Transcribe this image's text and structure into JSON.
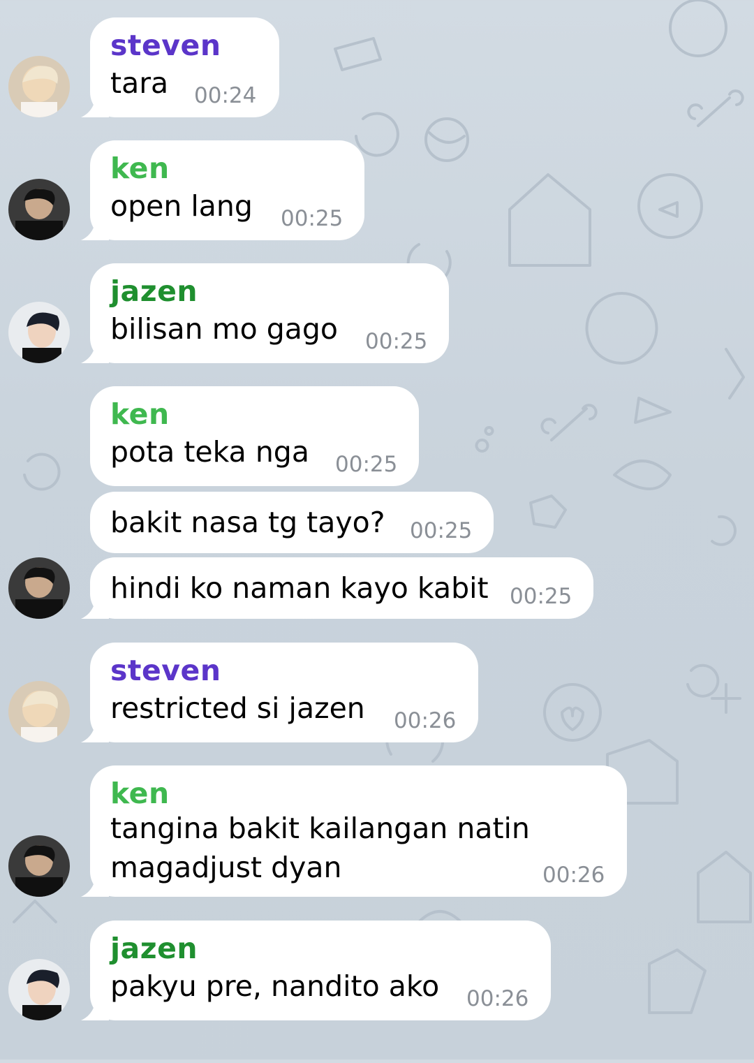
{
  "colors": {
    "steven": "#5b35c9",
    "ken": "#3fb84f",
    "jazen": "#1f8f2f",
    "bubble": "#ffffff",
    "time": "#8a8f96"
  },
  "messages": [
    {
      "sender": "steven",
      "text": "tara",
      "time": "00:24",
      "avatar": "steven-avatar"
    },
    {
      "sender": "ken",
      "text": "open lang",
      "time": "00:25",
      "avatar": "ken-avatar"
    },
    {
      "sender": "jazen",
      "text": "bilisan mo gago",
      "time": "00:25",
      "avatar": "jazen-avatar"
    },
    {
      "sender": "ken",
      "text": "pota teka nga",
      "time": "00:25"
    },
    {
      "text": "bakit nasa tg tayo?",
      "time": "00:25"
    },
    {
      "text": "hindi ko naman kayo kabit",
      "time": "00:25",
      "avatar": "ken-avatar"
    },
    {
      "sender": "steven",
      "text": "restricted si jazen",
      "time": "00:26",
      "avatar": "steven-avatar"
    },
    {
      "sender": "ken",
      "text_line1": "tangina bakit kailangan natin",
      "text_line2": "magadjust dyan",
      "time": "00:26",
      "avatar": "ken-avatar"
    },
    {
      "sender": "jazen",
      "text": "pakyu pre, nandito ako",
      "time": "00:26",
      "avatar": "jazen-avatar"
    }
  ]
}
